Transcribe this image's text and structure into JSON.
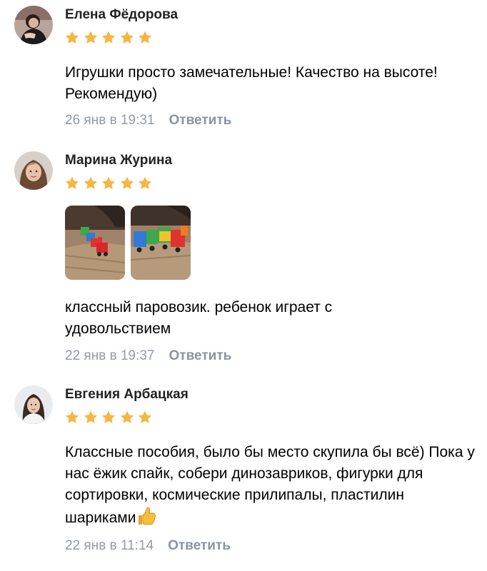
{
  "reviews": [
    {
      "author": "Елена Фёдорова",
      "rating": 5,
      "text": "Игрушки просто замечательные! Качество на высоте! Рекомендую)",
      "date": "26 янв в 19:31",
      "reply_label": "Ответить"
    },
    {
      "author": "Марина Журина",
      "rating": 5,
      "text": "классный паровозик. ребенок играет с удовольствием",
      "date": "22 янв в 19:37",
      "reply_label": "Ответить",
      "photos": [
        "toy-train-photo",
        "toy-train-photo"
      ]
    },
    {
      "author": "Евгения Арбацкая",
      "rating": 5,
      "text": "Классные пособия, было бы место скупила бы всё) Пока у нас ёжик спайк, собери динозавриков, фигурки для сортировки, космические прилипалы, пластилин шариками",
      "emoji": "thumbs-up-icon",
      "date": "22 янв в 11:14",
      "reply_label": "Ответить"
    }
  ],
  "colors": {
    "star": "#f5b642",
    "date": "#939aa5",
    "reply": "#8a93a0",
    "author": "#222222"
  }
}
